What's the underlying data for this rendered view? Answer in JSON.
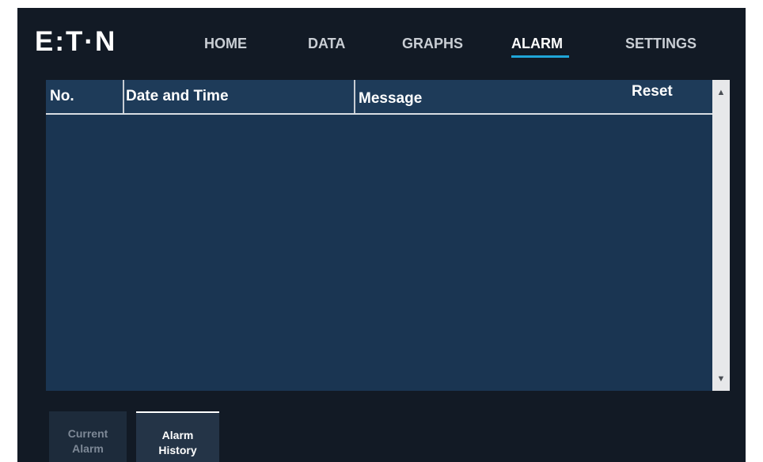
{
  "brand": {
    "logo_text": "E:T·N"
  },
  "nav": {
    "items": [
      {
        "label": "HOME",
        "active": false
      },
      {
        "label": "DATA",
        "active": false
      },
      {
        "label": "GRAPHS",
        "active": false
      },
      {
        "label": "ALARM",
        "active": true
      },
      {
        "label": "SETTINGS",
        "active": false
      }
    ]
  },
  "alarm_table": {
    "columns": [
      "No.",
      "Date and Time",
      "Message"
    ],
    "reset_label": "Reset",
    "rows": []
  },
  "scrollbar": {
    "up_icon": "triangle-up-icon",
    "down_icon": "triangle-down-icon"
  },
  "tabs": [
    {
      "line1": "Current",
      "line2": "Alarm",
      "active": false
    },
    {
      "line1": "Alarm",
      "line2": "History",
      "active": true
    }
  ],
  "colors": {
    "background": "#121a25",
    "table": "#1a3552",
    "accent": "#1fa6d9"
  }
}
